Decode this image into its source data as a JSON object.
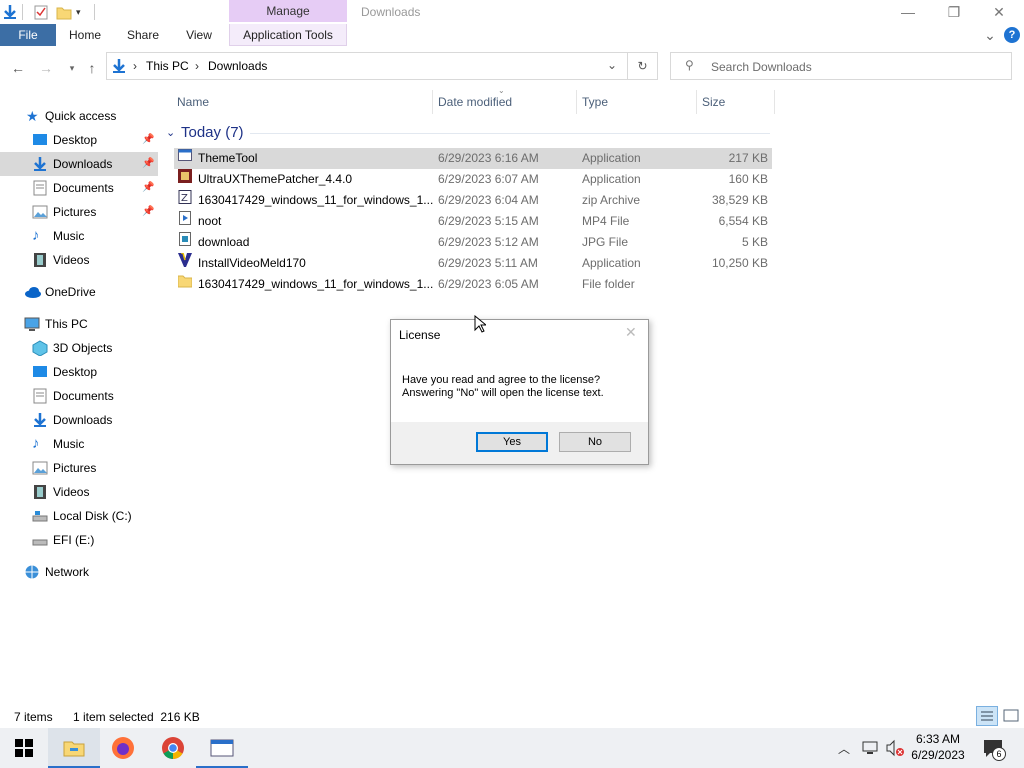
{
  "window": {
    "title": "Downloads",
    "context_tab": "Manage",
    "controls": {
      "minimize": "—",
      "restore": "❐",
      "close": "✕"
    }
  },
  "ribbon": {
    "tabs": [
      "File",
      "Home",
      "Share",
      "View",
      "Application Tools"
    ],
    "collapse_glyph": "⌄",
    "help_glyph": "?"
  },
  "address": {
    "crumbs": [
      "This PC",
      "Downloads"
    ],
    "separator": "›",
    "search_placeholder": "Search Downloads"
  },
  "nav": {
    "quick_access": "Quick access",
    "quick_items": [
      "Desktop",
      "Downloads",
      "Documents",
      "Pictures",
      "Music",
      "Videos"
    ],
    "onedrive": "OneDrive",
    "this_pc": "This PC",
    "pc_items": [
      "3D Objects",
      "Desktop",
      "Documents",
      "Downloads",
      "Music",
      "Pictures",
      "Videos",
      "Local Disk (C:)",
      "EFI (E:)"
    ],
    "network": "Network"
  },
  "columns": [
    "Name",
    "Date modified",
    "Type",
    "Size"
  ],
  "group_label": "Today (7)",
  "files": [
    {
      "name": "ThemeTool",
      "date": "6/29/2023 6:16 AM",
      "type": "Application",
      "size": "217 KB",
      "icon": "app-window-icon"
    },
    {
      "name": "UltraUXThemePatcher_4.4.0",
      "date": "6/29/2023 6:07 AM",
      "type": "Application",
      "size": "160 KB",
      "icon": "installer-icon"
    },
    {
      "name": "1630417429_windows_11_for_windows_1...",
      "date": "6/29/2023 6:04 AM",
      "type": "zip Archive",
      "size": "38,529 KB",
      "icon": "zip-icon"
    },
    {
      "name": "noot",
      "date": "6/29/2023 5:15 AM",
      "type": "MP4 File",
      "size": "6,554 KB",
      "icon": "video-file-icon"
    },
    {
      "name": "download",
      "date": "6/29/2023 5:12 AM",
      "type": "JPG File",
      "size": "5 KB",
      "icon": "image-file-icon"
    },
    {
      "name": "InstallVideoMeld170",
      "date": "6/29/2023 5:11 AM",
      "type": "Application",
      "size": "10,250 KB",
      "icon": "installer-icon"
    },
    {
      "name": "1630417429_windows_11_for_windows_1...",
      "date": "6/29/2023 6:05 AM",
      "type": "File folder",
      "size": "",
      "icon": "folder-icon"
    }
  ],
  "dialog": {
    "title": "License",
    "line1": "Have you read and agree to the license?",
    "line2": "Answering \"No\" will open the license text.",
    "yes": "Yes",
    "no": "No",
    "close": "✕"
  },
  "status": {
    "items": "7 items",
    "selected": "1 item selected  216 KB"
  },
  "taskbar": {
    "time": "6:33 AM",
    "date": "6/29/2023",
    "notifications": "6"
  },
  "colors": {
    "accent": "#0078d7",
    "file_tab": "#3c6ea5",
    "manage_tab": "#e6ccf5",
    "selection": "#d9d9d9",
    "folder": "#f8d775"
  }
}
